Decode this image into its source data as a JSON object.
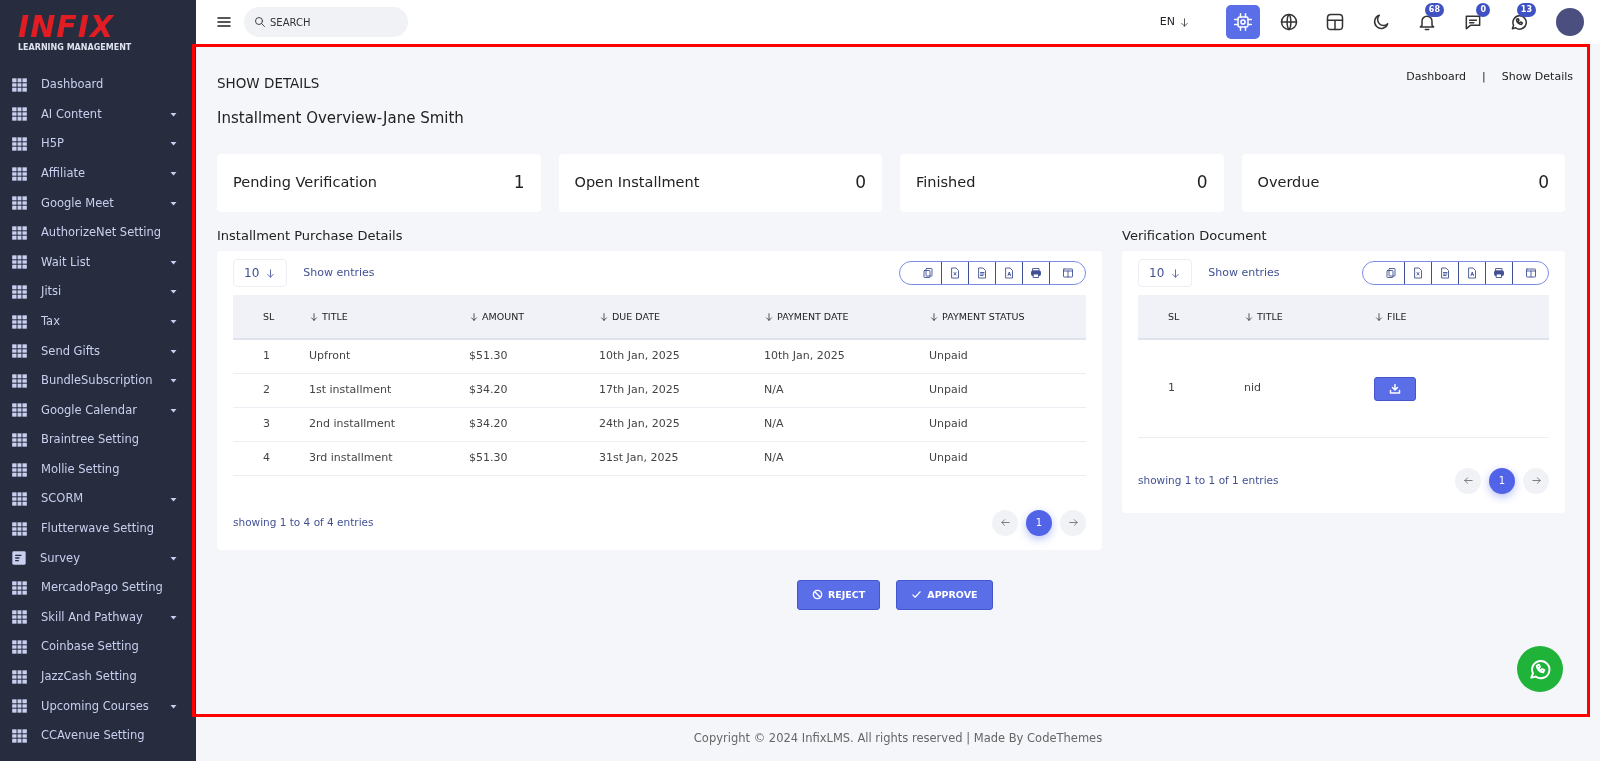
{
  "logo": {
    "wordmark": "INFIX",
    "tagline": "LEARNING MANAGEMENT"
  },
  "sidebar": {
    "items": [
      {
        "label": "Dashboard",
        "kind": "grid",
        "has_submenu": false
      },
      {
        "label": "AI Content",
        "kind": "grid",
        "has_submenu": true
      },
      {
        "label": "H5P",
        "kind": "grid",
        "has_submenu": true
      },
      {
        "label": "Affiliate",
        "kind": "grid",
        "has_submenu": true
      },
      {
        "label": "Google Meet",
        "kind": "grid",
        "has_submenu": true
      },
      {
        "label": "AuthorizeNet Setting",
        "kind": "grid",
        "has_submenu": false
      },
      {
        "label": "Wait List",
        "kind": "grid",
        "has_submenu": true
      },
      {
        "label": "Jitsi",
        "kind": "grid",
        "has_submenu": true
      },
      {
        "label": "Tax",
        "kind": "grid",
        "has_submenu": true
      },
      {
        "label": "Send Gifts",
        "kind": "grid",
        "has_submenu": true
      },
      {
        "label": "BundleSubscription",
        "kind": "grid",
        "has_submenu": true
      },
      {
        "label": "Google Calendar",
        "kind": "grid",
        "has_submenu": true
      },
      {
        "label": "Braintree Setting",
        "kind": "grid",
        "has_submenu": false
      },
      {
        "label": "Mollie Setting",
        "kind": "grid",
        "has_submenu": false
      },
      {
        "label": "SCORM",
        "kind": "grid",
        "has_submenu": true
      },
      {
        "label": "Flutterwave Setting",
        "kind": "grid",
        "has_submenu": false
      },
      {
        "label": "Survey",
        "kind": "survey",
        "has_submenu": true
      },
      {
        "label": "MercadoPago Setting",
        "kind": "grid",
        "has_submenu": false
      },
      {
        "label": "Skill And Pathway",
        "kind": "grid",
        "has_submenu": true
      },
      {
        "label": "Coinbase Setting",
        "kind": "grid",
        "has_submenu": false
      },
      {
        "label": "JazzCash Setting",
        "kind": "grid",
        "has_submenu": false
      },
      {
        "label": "Upcoming Courses",
        "kind": "grid",
        "has_submenu": true
      },
      {
        "label": "CCAvenue Setting",
        "kind": "grid",
        "has_submenu": false
      }
    ]
  },
  "topbar": {
    "search": {
      "placeholder": "SEARCH"
    },
    "language": "EN",
    "icons": [
      {
        "kind": "ai",
        "highlighted": true
      },
      {
        "kind": "globe",
        "highlighted": false
      },
      {
        "kind": "layout",
        "highlighted": false
      },
      {
        "kind": "moon",
        "highlighted": false
      },
      {
        "kind": "bell",
        "highlighted": false,
        "badge": "68"
      },
      {
        "kind": "chat",
        "highlighted": false,
        "badge": "0"
      },
      {
        "kind": "whatsapp",
        "highlighted": false,
        "badge": "13"
      }
    ]
  },
  "page": {
    "title": "SHOW DETAILS",
    "breadcrumb": [
      "Dashboard",
      "Show Details"
    ],
    "breadcrumb_separator": "|",
    "heading": "Installment Overview-Jane Smith"
  },
  "stats": [
    {
      "label": "Pending Verification",
      "value": "1"
    },
    {
      "label": "Open Installment",
      "value": "0"
    },
    {
      "label": "Finished",
      "value": "0"
    },
    {
      "label": "Overdue",
      "value": "0"
    }
  ],
  "tables": [
    {
      "title": "Installment Purchase Details",
      "page_size": "10",
      "show_entries": "Show entries",
      "columns": [
        {
          "label": "SL",
          "sortable": false
        },
        {
          "label": "TITLE",
          "sortable": true
        },
        {
          "label": "AMOUNT",
          "sortable": true
        },
        {
          "label": "DUE DATE",
          "sortable": true
        },
        {
          "label": "PAYMENT DATE",
          "sortable": true
        },
        {
          "label": "PAYMENT STATUS",
          "sortable": true
        }
      ],
      "rows": [
        [
          "1",
          "Upfront",
          "$51.30",
          "10th Jan, 2025",
          "10th Jan, 2025",
          "Unpaid"
        ],
        [
          "2",
          "1st installment",
          "$34.20",
          "17th Jan, 2025",
          "N/A",
          "Unpaid"
        ],
        [
          "3",
          "2nd installment",
          "$34.20",
          "24th Jan, 2025",
          "N/A",
          "Unpaid"
        ],
        [
          "4",
          "3rd installment",
          "$51.30",
          "31st Jan, 2025",
          "N/A",
          "Unpaid"
        ]
      ],
      "summary": "showing 1 to 4 of 4 entries",
      "pages": [
        {
          "label": "1",
          "selected": true
        }
      ]
    },
    {
      "title": "Verification Document",
      "page_size": "10",
      "show_entries": "Show entries",
      "columns": [
        {
          "label": "SL",
          "sortable": false
        },
        {
          "label": "TITLE",
          "sortable": true
        },
        {
          "label": "FILE",
          "sortable": true
        }
      ],
      "rows": [
        [
          "1",
          "nid",
          {
            "kind": "download"
          }
        ]
      ],
      "summary": "showing 1 to 1 of 1 entries",
      "pages": [
        {
          "label": "1",
          "selected": true
        }
      ]
    }
  ],
  "actions": [
    {
      "label": "REJECT",
      "kind": "reject"
    },
    {
      "label": "APPROVE",
      "kind": "approve"
    }
  ],
  "footer": "Copyright © 2024 InfixLMS. All rights reserved | Made By CodeThemes"
}
